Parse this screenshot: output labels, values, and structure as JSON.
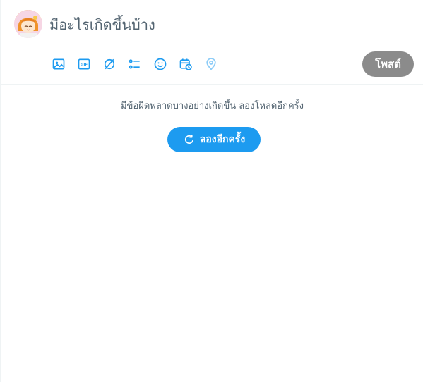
{
  "composer": {
    "avatar_icon": "user-avatar",
    "prompt_placeholder": "มีอะไรเกิดขึ้นบ้าง",
    "post_label": "โพสต์",
    "post_button_color": "#8b8b8b",
    "accent_color": "#1d9bf0",
    "tools": [
      {
        "icon": "image-icon"
      },
      {
        "icon": "gif-icon",
        "label": "GIF"
      },
      {
        "icon": "grok-icon"
      },
      {
        "icon": "poll-icon"
      },
      {
        "icon": "emoji-icon"
      },
      {
        "icon": "schedule-icon"
      },
      {
        "icon": "location-icon"
      }
    ]
  },
  "feed": {
    "error_message": "มีข้อผิดพลาดบางอย่างเกิดขึ้น ลองโหลดอีกครั้ง",
    "retry_label": "ลองอีกครั้ง",
    "retry_icon": "refresh-icon"
  }
}
